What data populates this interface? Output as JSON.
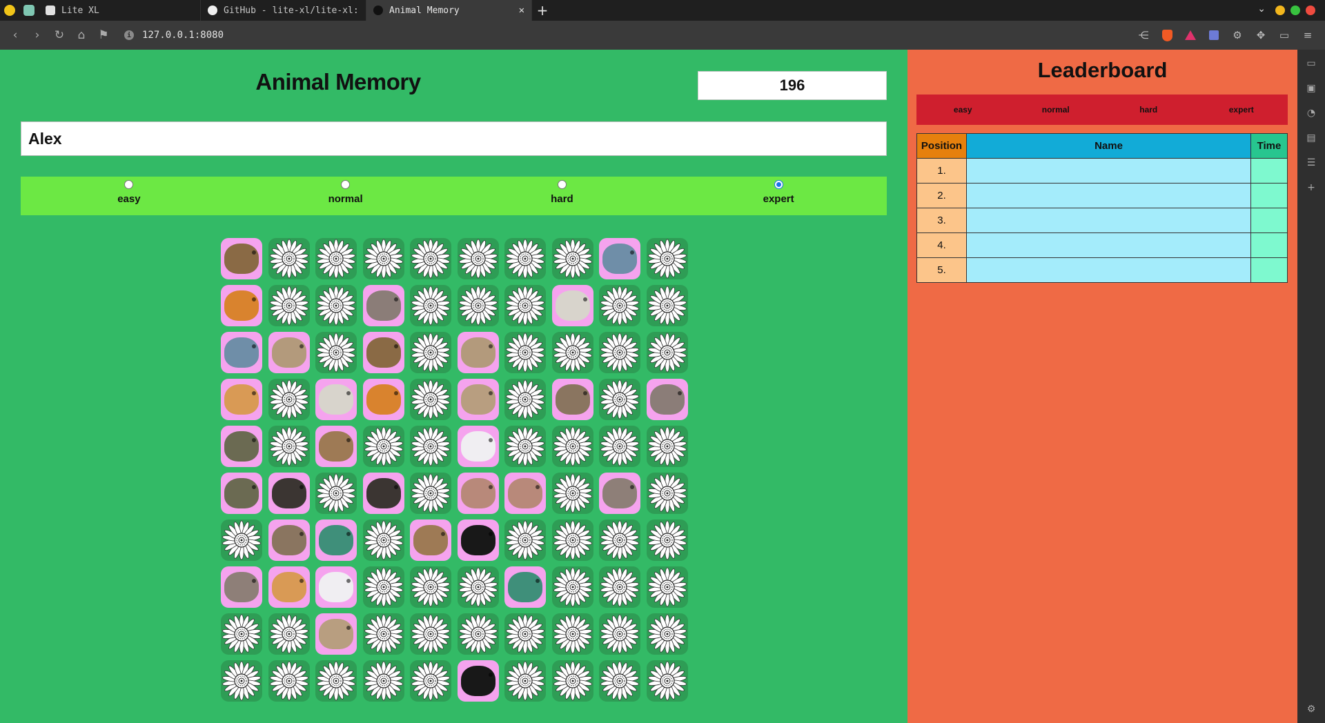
{
  "browser": {
    "tabs": [
      {
        "title": "Lite XL",
        "active": false
      },
      {
        "title": "GitHub - lite-xl/lite-xl:",
        "active": false
      },
      {
        "title": "Animal Memory",
        "active": true
      }
    ],
    "url": "127.0.0.1:8080",
    "colors": {
      "chrome": "#3a3a3a",
      "tabbar": "#1f1f1f"
    }
  },
  "game": {
    "title": "Animal Memory",
    "timer": "196",
    "player_name": "Alex",
    "difficulties": [
      {
        "label": "easy",
        "selected": false
      },
      {
        "label": "normal",
        "selected": false
      },
      {
        "label": "hard",
        "selected": false
      },
      {
        "label": "expert",
        "selected": true
      }
    ],
    "board": [
      [
        "tortoise",
        null,
        null,
        null,
        null,
        null,
        null,
        null,
        "shark",
        null
      ],
      [
        "tiger",
        null,
        null,
        "rhino",
        null,
        null,
        null,
        "white-tiger",
        null,
        null
      ],
      [
        "shark",
        "owl",
        null,
        "tortoise",
        null,
        "owl",
        null,
        null,
        null,
        null
      ],
      [
        "corgi",
        null,
        "white-tiger",
        "tiger",
        null,
        "sheep",
        null,
        "marmot",
        null,
        "rhino"
      ],
      [
        "crocodile",
        null,
        "monkey",
        null,
        null,
        "goat",
        null,
        null,
        null,
        null
      ],
      [
        "crocodile",
        "chimpanzee",
        null,
        "chimpanzee",
        null,
        "elephant",
        "elephant",
        null,
        "rabbit",
        null
      ],
      [
        null,
        "marmot",
        "peacock",
        null,
        "monkey",
        "panther",
        null,
        null,
        null,
        null
      ],
      [
        "rabbit",
        "corgi",
        "goat",
        null,
        null,
        null,
        "peacock",
        null,
        null,
        null
      ],
      [
        null,
        null,
        "sheep",
        null,
        null,
        null,
        null,
        null,
        null,
        null
      ],
      [
        null,
        null,
        null,
        null,
        null,
        "panther",
        null,
        null,
        null,
        null
      ]
    ],
    "animal_colors": {
      "tortoise": "#8a6a45",
      "shark": "#6f8ea8",
      "tiger": "#d9832e",
      "rhino": "#8b7d78",
      "white-tiger": "#d8d4cc",
      "owl": "#b39a7c",
      "corgi": "#d99a55",
      "sheep": "#b89e80",
      "marmot": "#8a7560",
      "crocodile": "#6b6a52",
      "monkey": "#9e7a55",
      "goat": "#f0eef2",
      "chimpanzee": "#3b3532",
      "elephant": "#b8897a",
      "rabbit": "#8e7f78",
      "peacock": "#3f8f7a",
      "panther": "#181818"
    },
    "colors": {
      "background": "#33ba66",
      "difficulty_bar": "#6ce844",
      "card_face": "#f5a3ee",
      "card_back": "#2e9d55"
    }
  },
  "leaderboard": {
    "title": "Leaderboard",
    "tabs": [
      "easy",
      "normal",
      "hard",
      "expert"
    ],
    "headers": {
      "position": "Position",
      "name": "Name",
      "time": "Time"
    },
    "rows": [
      {
        "position": "1.",
        "name": "",
        "time": ""
      },
      {
        "position": "2.",
        "name": "",
        "time": ""
      },
      {
        "position": "3.",
        "name": "",
        "time": ""
      },
      {
        "position": "4.",
        "name": "",
        "time": ""
      },
      {
        "position": "5.",
        "name": "",
        "time": ""
      }
    ],
    "colors": {
      "background": "#ef6a45",
      "tabs": "#cf1f2e"
    }
  }
}
